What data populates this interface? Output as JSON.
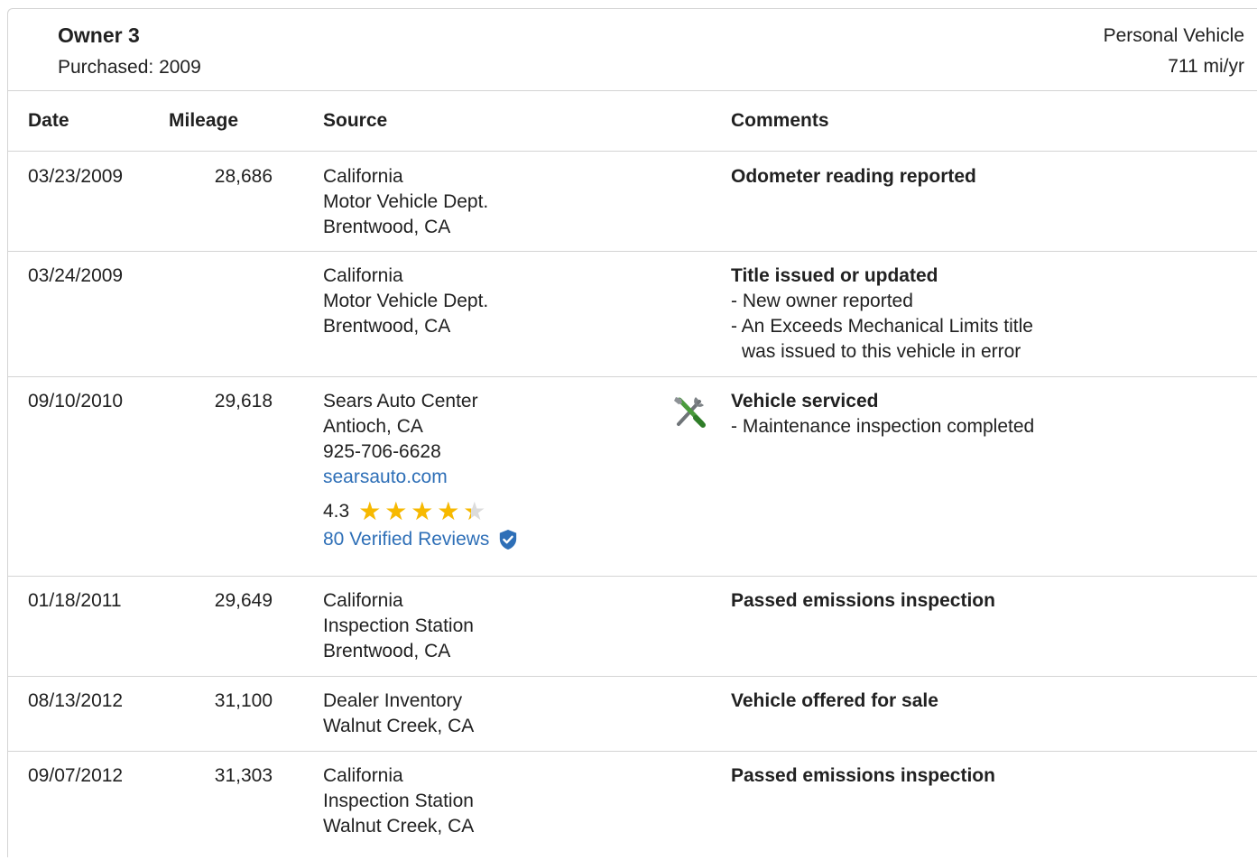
{
  "owner": {
    "title": "Owner 3",
    "purchased": "Purchased: 2009",
    "vehicle_type": "Personal Vehicle",
    "miles_per_year": "711 mi/yr"
  },
  "columns": {
    "date": "Date",
    "mileage": "Mileage",
    "source": "Source",
    "comments": "Comments"
  },
  "records": [
    {
      "date": "03/23/2009",
      "mileage": "28,686",
      "source": [
        "California",
        "Motor Vehicle Dept.",
        "Brentwood, CA"
      ],
      "comment_title": "Odometer reading reported"
    },
    {
      "date": "03/24/2009",
      "mileage": "",
      "source": [
        "California",
        "Motor Vehicle Dept.",
        "Brentwood, CA"
      ],
      "comment_title": "Title issued or updated",
      "comment_lines": [
        "- New owner reported",
        "- An Exceeds Mechanical Limits title",
        "was issued to this vehicle in error"
      ]
    },
    {
      "date": "09/10/2010",
      "mileage": "29,618",
      "source": [
        "Sears Auto Center",
        "Antioch, CA",
        "925-706-6628"
      ],
      "link": "searsauto.com",
      "rating": "4.3",
      "rating_value": 4.3,
      "reviews": "80 Verified Reviews",
      "icon": "service-tools-icon",
      "comment_title": "Vehicle serviced",
      "comment_lines": [
        "- Maintenance inspection completed"
      ]
    },
    {
      "date": "01/18/2011",
      "mileage": "29,649",
      "source": [
        "California",
        "Inspection Station",
        "Brentwood, CA"
      ],
      "comment_title": "Passed emissions inspection"
    },
    {
      "date": "08/13/2012",
      "mileage": "31,100",
      "source": [
        "Dealer Inventory",
        "Walnut Creek, CA"
      ],
      "comment_title": "Vehicle offered for sale"
    },
    {
      "date": "09/07/2012",
      "mileage": "31,303",
      "source": [
        "California",
        "Inspection Station",
        "Walnut Creek, CA"
      ],
      "comment_title": "Passed emissions inspection"
    }
  ],
  "colors": {
    "link": "#2e6fb7",
    "star": "#f7b900",
    "divider": "#d4d4d4"
  }
}
